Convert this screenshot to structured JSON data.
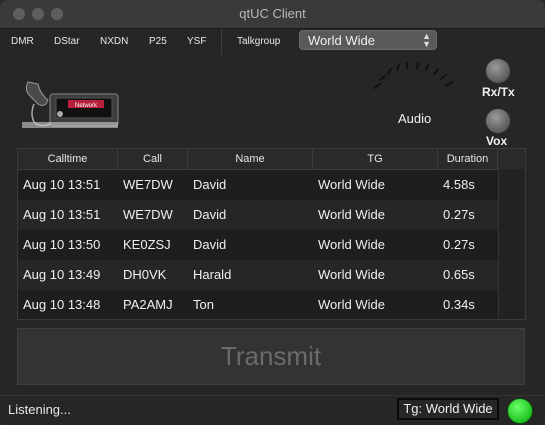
{
  "window": {
    "title": "qtUC Client"
  },
  "toolbar": {
    "modes": [
      "DMR",
      "DStar",
      "NXDN",
      "P25",
      "YSF"
    ],
    "talkgroup_label": "Talkgroup",
    "talkgroup_value": "World Wide"
  },
  "controls": {
    "audio_label": "Audio",
    "rxtx_label": "Rx/Tx",
    "vox_label": "Vox",
    "radio_brand": "Network"
  },
  "table": {
    "headers": [
      "Calltime",
      "Call",
      "Name",
      "TG",
      "Duration"
    ],
    "rows": [
      [
        "Aug 10 13:51",
        "WE7DW",
        "David",
        "World Wide",
        "4.58s"
      ],
      [
        "Aug 10 13:51",
        "WE7DW",
        "David",
        "World Wide",
        "0.27s"
      ],
      [
        "Aug 10 13:50",
        "KE0ZSJ",
        "David",
        "World Wide",
        "0.27s"
      ],
      [
        "Aug 10 13:49",
        "DH0VK",
        "Harald",
        "World Wide",
        "0.65s"
      ],
      [
        "Aug 10 13:48",
        "PA2AMJ",
        "Ton",
        "World Wide",
        "0.34s"
      ]
    ]
  },
  "transmit": {
    "label": "Transmit"
  },
  "status": {
    "text": "Listening...",
    "tg": "Tg: World Wide",
    "indicator_color": "#22cc22"
  }
}
